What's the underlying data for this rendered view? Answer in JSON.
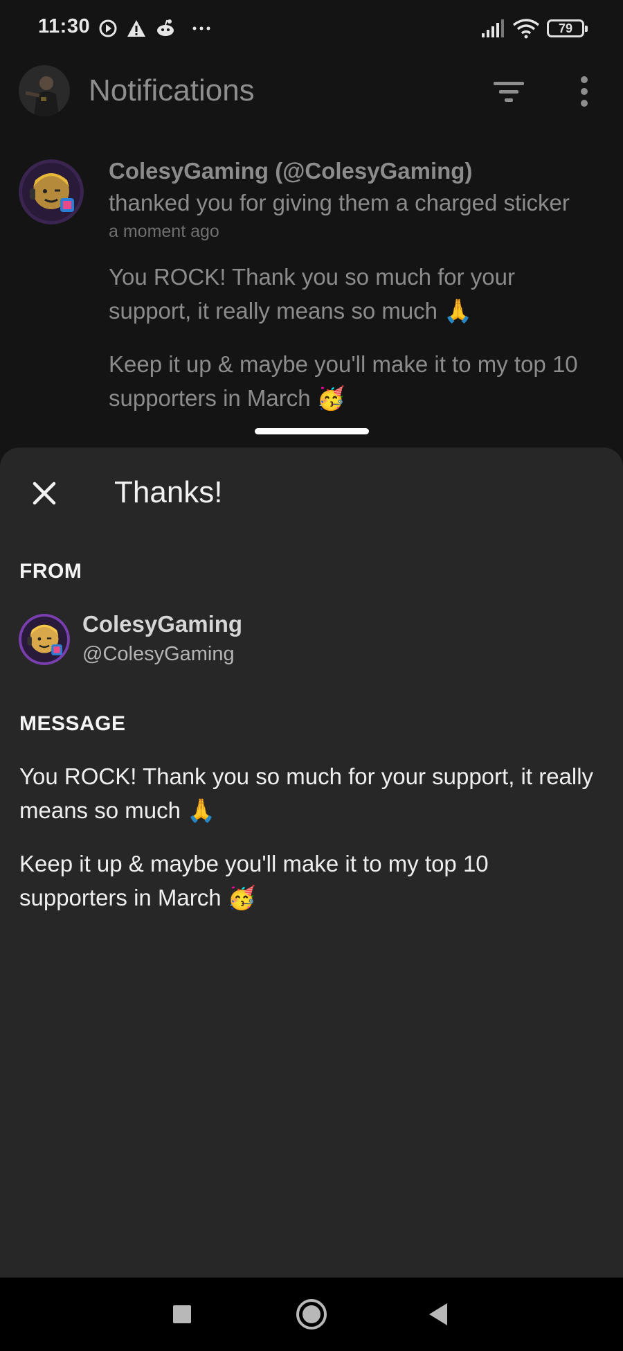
{
  "status_bar": {
    "time": "11:30",
    "battery": "79",
    "icons": [
      "play-circle-icon",
      "warning-icon",
      "reddit-icon",
      "more-dots-icon",
      "signal-icon",
      "wifi-icon",
      "battery-icon"
    ]
  },
  "app_bar": {
    "title": "Notifications",
    "icons": [
      "filter-icon",
      "more-vert-icon"
    ]
  },
  "notification": {
    "title": "ColesyGaming (@ColesyGaming)",
    "description": "thanked you for giving them a charged sticker",
    "time": "a moment ago",
    "message_1": "You ROCK! Thank you so much for your support, it really means so much 🙏",
    "message_2": "Keep it up & maybe you'll make it to my top 10 supporters in March 🥳"
  },
  "sheet": {
    "title": "Thanks!",
    "from_label": "FROM",
    "from_name": "ColesyGaming",
    "from_handle": "@ColesyGaming",
    "message_label": "MESSAGE",
    "message_1": "You ROCK! Thank you so much for your support, it really means so much 🙏",
    "message_2": "Keep it up & maybe you'll make it to my top 10 supporters in March 🥳"
  },
  "nav_bar": {
    "icons": [
      "recents-square-icon",
      "home-circle-icon",
      "back-triangle-icon"
    ]
  },
  "colors": {
    "background": "#141414",
    "sheet": "#272727",
    "text": "#efefef",
    "dim_text": "#8c8c8c",
    "avatar_ring": "#8e44ad"
  }
}
